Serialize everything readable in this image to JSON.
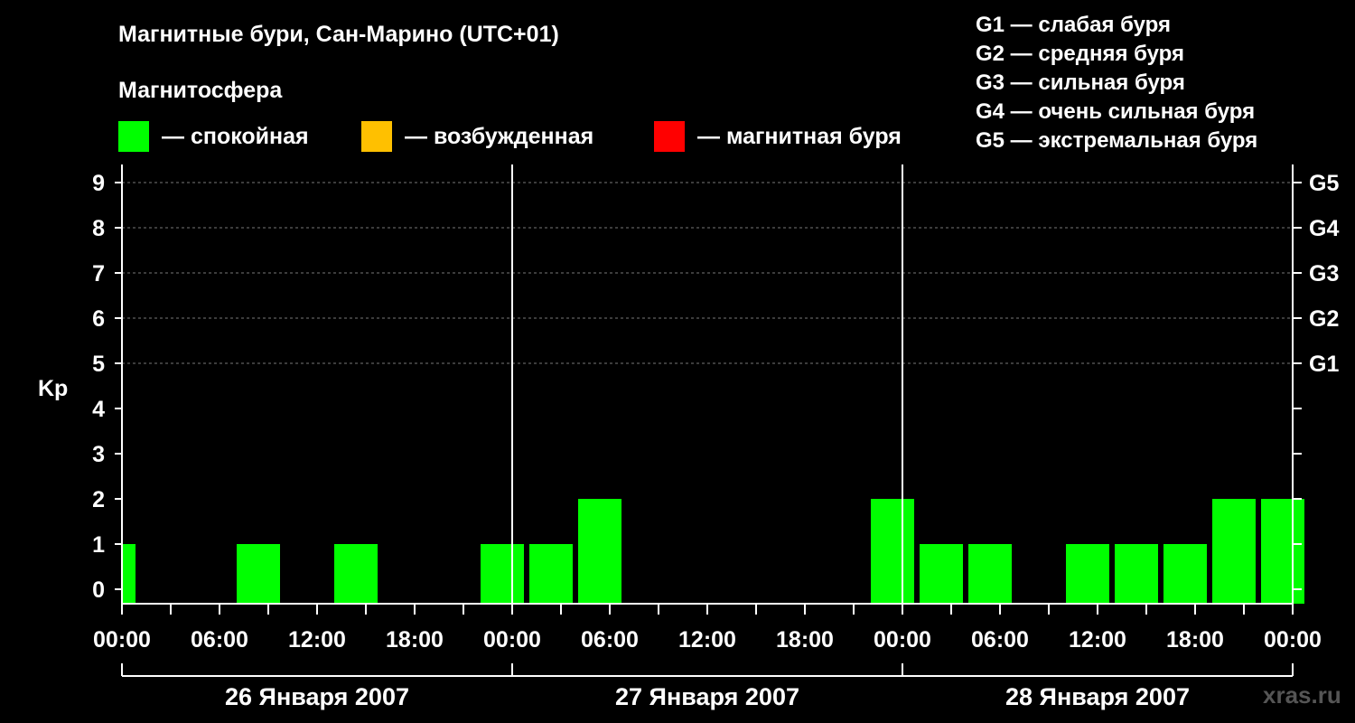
{
  "title": "Магнитные бури, Сан-Марино (UTC+01)",
  "subtitle": "Магнитосфера",
  "legend": [
    {
      "label": "— спокойная",
      "color": "#00ff00"
    },
    {
      "label": "— возбужденная",
      "color": "#ffc000"
    },
    {
      "label": "— магнитная буря",
      "color": "#ff0000"
    }
  ],
  "storm_scale": [
    "G1 — слабая буря",
    "G2 — средняя буря",
    "G3 — сильная буря",
    "G4 — очень сильная буря",
    "G5 — экстремальная буря"
  ],
  "watermark": "xras.ru",
  "chart_data": {
    "type": "bar",
    "ylabel": "Kp",
    "ylim": [
      0,
      9
    ],
    "yticks": [
      "0",
      "1",
      "2",
      "3",
      "4",
      "5",
      "6",
      "7",
      "8",
      "9"
    ],
    "right_ticks": [
      {
        "kp": 5,
        "label": "G1"
      },
      {
        "kp": 6,
        "label": "G2"
      },
      {
        "kp": 7,
        "label": "G3"
      },
      {
        "kp": 8,
        "label": "G4"
      },
      {
        "kp": 9,
        "label": "G5"
      }
    ],
    "xtick_labels": [
      "00:00",
      "06:00",
      "12:00",
      "18:00",
      "00:00",
      "06:00",
      "12:00",
      "18:00",
      "00:00",
      "06:00",
      "12:00",
      "18:00",
      "00:00"
    ],
    "days": [
      "26 Января 2007",
      "27 Января 2007",
      "28 Января 2007"
    ],
    "grid": true,
    "series": [
      {
        "values": [
          {
            "start_hour": 0,
            "kp": 1,
            "color": "#00ff00"
          },
          {
            "start_hour": 7,
            "kp": 1,
            "color": "#00ff00"
          },
          {
            "start_hour": 13,
            "kp": 1,
            "color": "#00ff00"
          },
          {
            "start_hour": 22,
            "kp": 1,
            "color": "#00ff00"
          },
          {
            "start_hour": 25,
            "kp": 1,
            "color": "#00ff00"
          },
          {
            "start_hour": 28,
            "kp": 2,
            "color": "#00ff00"
          },
          {
            "start_hour": 46,
            "kp": 2,
            "color": "#00ff00"
          },
          {
            "start_hour": 49,
            "kp": 1,
            "color": "#00ff00"
          },
          {
            "start_hour": 52,
            "kp": 1,
            "color": "#00ff00"
          },
          {
            "start_hour": 58,
            "kp": 1,
            "color": "#00ff00"
          },
          {
            "start_hour": 61,
            "kp": 1,
            "color": "#00ff00"
          },
          {
            "start_hour": 64,
            "kp": 1,
            "color": "#00ff00"
          },
          {
            "start_hour": 67,
            "kp": 2,
            "color": "#00ff00"
          },
          {
            "start_hour": 70,
            "kp": 2,
            "color": "#00ff00"
          }
        ]
      }
    ]
  }
}
